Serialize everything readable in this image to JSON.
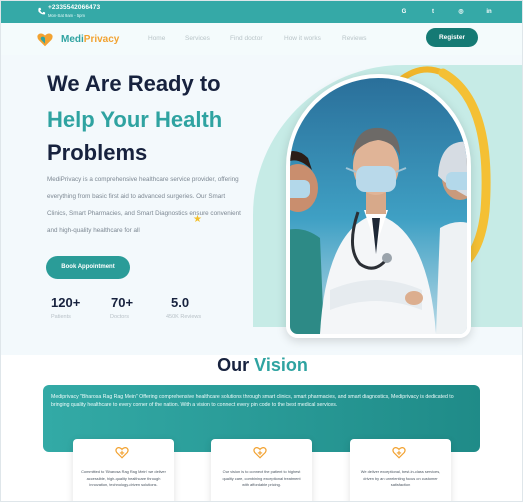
{
  "topbar": {
    "phone": "+2335542066473",
    "hours": "Mon-Sat 9am - 5pm",
    "social_icons": [
      "google-icon",
      "twitter-icon",
      "instagram-icon",
      "linkedin-icon"
    ],
    "social_labels": [
      "G",
      "t",
      "◎",
      "in"
    ]
  },
  "nav": {
    "brand_part1": "Medi",
    "brand_part2": "Privacy",
    "links": [
      "Home",
      "Services",
      "Find doctor",
      "How it works",
      "Reviews"
    ],
    "register_label": "Register"
  },
  "hero": {
    "heading_line1": "We Are Ready to",
    "heading_line2": "Help Your Health",
    "heading_line3": "Problems",
    "description": "MediPrivacy is a comprehensive healthcare service provider, offering everything from basic first aid to advanced surgeries. Our Smart Clinics, Smart Pharmacies, and Smart Diagnostics ensure convenient and high-quality healthcare for all",
    "cta_label": "Book Appointment",
    "stats": [
      {
        "value": "120+",
        "label": "Patients"
      },
      {
        "value": "70+",
        "label": "Doctors"
      },
      {
        "value": "5.0",
        "label": "450K Reviews"
      }
    ]
  },
  "vision": {
    "title_part1": "Our",
    "title_part2": "Vision",
    "banner_text": "Mediprivacy \"Bharosa Rag Rag Mein\" Offering comprehensive healthcare solutions through smart clinics, smart pharmacies, and smart diagnostics, Mediprivacy is dedicated to bringing quality healthcare to every corner of the nation. With a vision to connect every pin code to the best medical services.",
    "cards": [
      {
        "icon": "heart-plus-icon",
        "text": "Committed to 'Bharosa Rag Rag Mein' we deliver accessible, high-quality healthcare through innovation, technology-driven solutions."
      },
      {
        "icon": "heart-plus-icon",
        "text": "Our vision is to connect the patient to highest quality care, combining exceptional treatment with affordable pricing."
      },
      {
        "icon": "heart-plus-icon",
        "text": "We deliver exceptional, best-in-class services, driven by an unrelenting focus on customer satisfaction"
      }
    ]
  },
  "colors": {
    "primary_teal": "#2fa3a1",
    "dark_teal": "#157a74",
    "navy": "#17223e",
    "accent_orange": "#f2a231"
  }
}
